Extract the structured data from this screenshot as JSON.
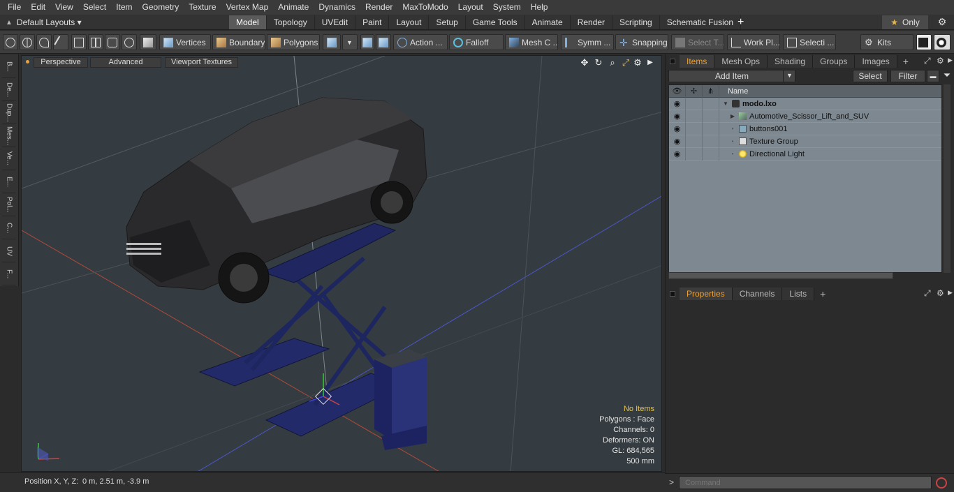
{
  "menu": [
    "File",
    "Edit",
    "View",
    "Select",
    "Item",
    "Geometry",
    "Texture",
    "Vertex Map",
    "Animate",
    "Dynamics",
    "Render",
    "MaxToModo",
    "Layout",
    "System",
    "Help"
  ],
  "layout_switch": "Default Layouts ▾",
  "tabs": [
    "Model",
    "Topology",
    "UVEdit",
    "Paint",
    "Layout",
    "Setup",
    "Game Tools",
    "Animate",
    "Render",
    "Scripting",
    "Schematic Fusion"
  ],
  "active_tab": "Model",
  "only_label": "Only",
  "toolbar": {
    "vertices": "Vertices",
    "boundary": "Boundary",
    "polygons": "Polygons",
    "action": "Action ...",
    "falloff": "Falloff",
    "mesh_c": "Mesh C ...",
    "symm": "Symm ...",
    "snapping": "Snapping",
    "select_t": "Select T...",
    "work_pl": "Work Pl...",
    "selecti": "Selecti ...",
    "kits": "Kits"
  },
  "left_strip": [
    "B...",
    "De...",
    "Dup...",
    "Mes...",
    "Ve...",
    "E...",
    "Pol...",
    "C...",
    "UV",
    "F..."
  ],
  "viewport": {
    "perspective": "Perspective",
    "advanced": "Advanced",
    "viewport_textures": "Viewport Textures",
    "info": {
      "items": "No Items",
      "polygons": "Polygons : Face",
      "channels": "Channels: 0",
      "deformers": "Deformers: ON",
      "gl": "GL: 684,565",
      "scale": "500 mm"
    }
  },
  "status": {
    "position_label": "Position X, Y, Z:",
    "position_value": "0 m, 2.51 m, -3.9 m"
  },
  "items_panel": {
    "tabs": [
      "Items",
      "Mesh Ops",
      "Shading",
      "Groups",
      "Images"
    ],
    "active": "Items",
    "add_item": "Add Item",
    "select": "Select",
    "filter": "Filter",
    "col_name": "Name",
    "rows": [
      {
        "name": "modo.lxo"
      },
      {
        "name": "Automotive_Scissor_Lift_and_SUV"
      },
      {
        "name": "buttons001"
      },
      {
        "name": "Texture Group"
      },
      {
        "name": "Directional Light"
      }
    ]
  },
  "props_panel": {
    "tabs": [
      "Properties",
      "Channels",
      "Lists"
    ],
    "active": "Properties"
  },
  "command": {
    "placeholder": "Command"
  },
  "colors": {
    "accent": "#f0a030",
    "viewport_bg": "#353c41",
    "tree_bg": "#7e8890",
    "info_highlight": "#e8c34a",
    "lift_blue": "#232a6a"
  }
}
